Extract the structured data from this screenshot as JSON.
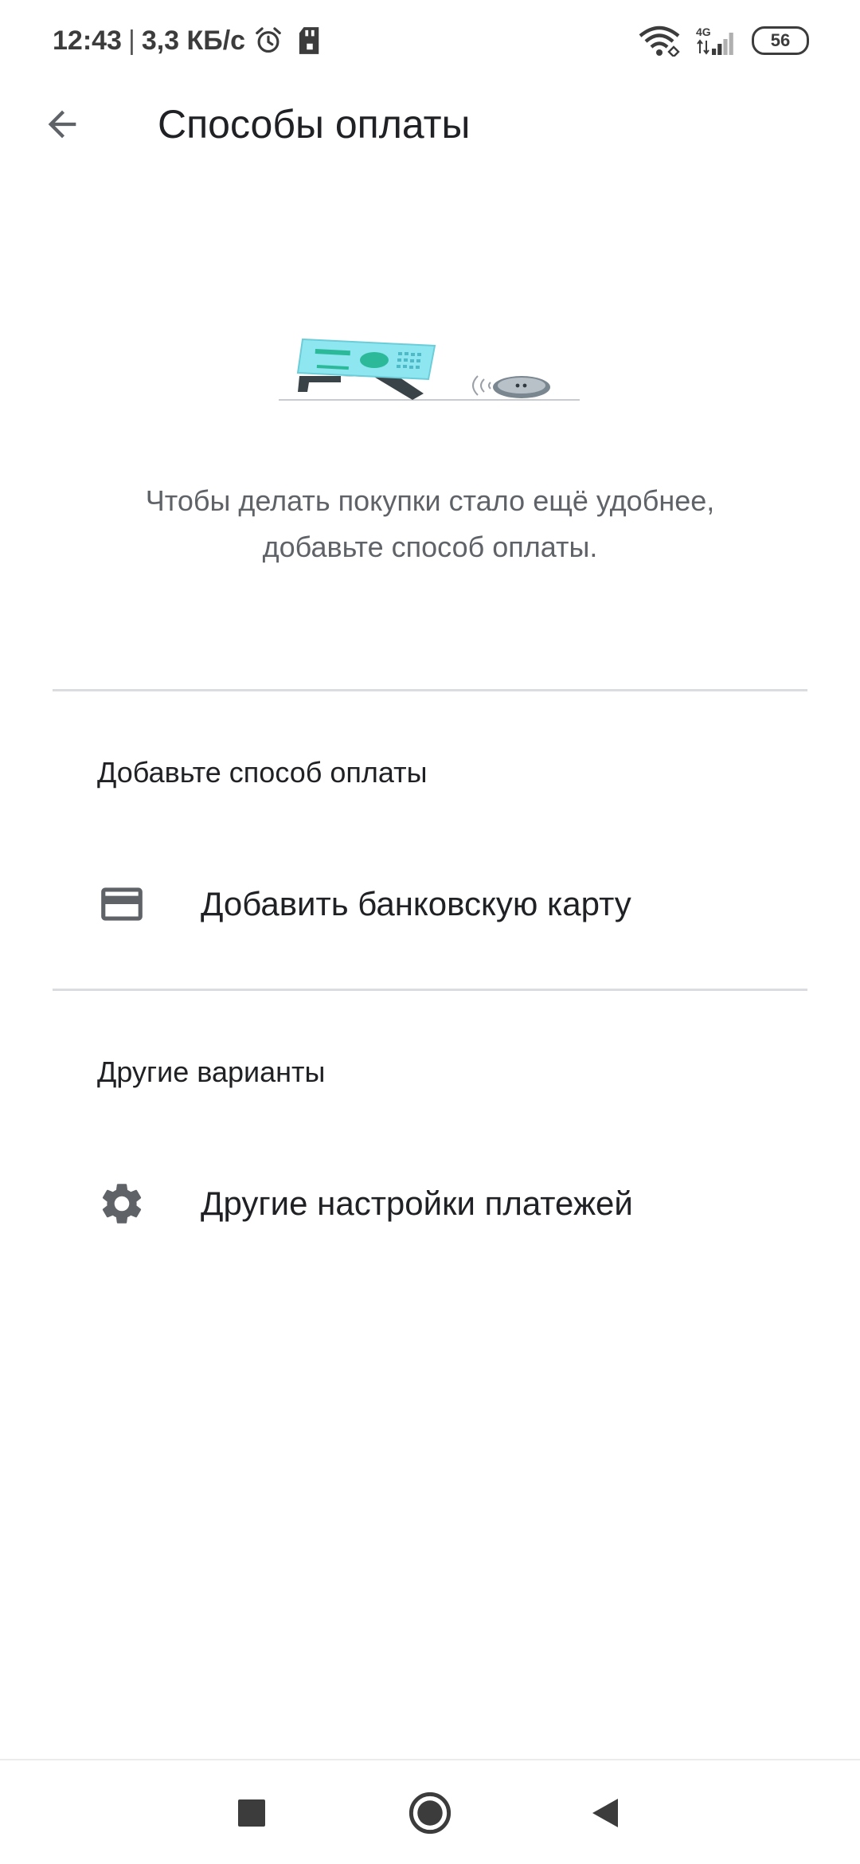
{
  "status_bar": {
    "time": "12:43",
    "separator": "|",
    "network_speed": "3,3 КБ/с",
    "cellular_label": "4G",
    "battery_level": "56",
    "icons": [
      "alarm-icon",
      "sd-card-icon",
      "wifi-icon",
      "cellular-signal-icon",
      "battery-icon"
    ]
  },
  "app_bar": {
    "title": "Способы оплаты",
    "back_icon": "arrow-back-icon"
  },
  "illustration": {
    "icon": "payment-card-illustration",
    "colors": {
      "card": "#8ee6f0",
      "card_accent": "#2bb99a",
      "coin": "#7b8790",
      "line": "#9aa0a6"
    }
  },
  "promo": {
    "line1": "Чтобы делать покупки стало ещё удобнее,",
    "line2": "добавьте способ оплаты."
  },
  "sections": [
    {
      "header": "Добавьте способ оплаты",
      "items": [
        {
          "label": "Добавить банковскую карту",
          "icon": "credit-card-icon"
        }
      ]
    },
    {
      "header": "Другие варианты",
      "items": [
        {
          "label": "Другие настройки платежей",
          "icon": "gear-icon"
        }
      ]
    }
  ],
  "nav_bar": {
    "icons": [
      "recents-square-icon",
      "home-circle-icon",
      "back-triangle-icon"
    ]
  },
  "colors": {
    "text_primary": "#202124",
    "text_secondary": "#5f6368",
    "icon": "#5f6368",
    "divider": "#dadce0"
  }
}
